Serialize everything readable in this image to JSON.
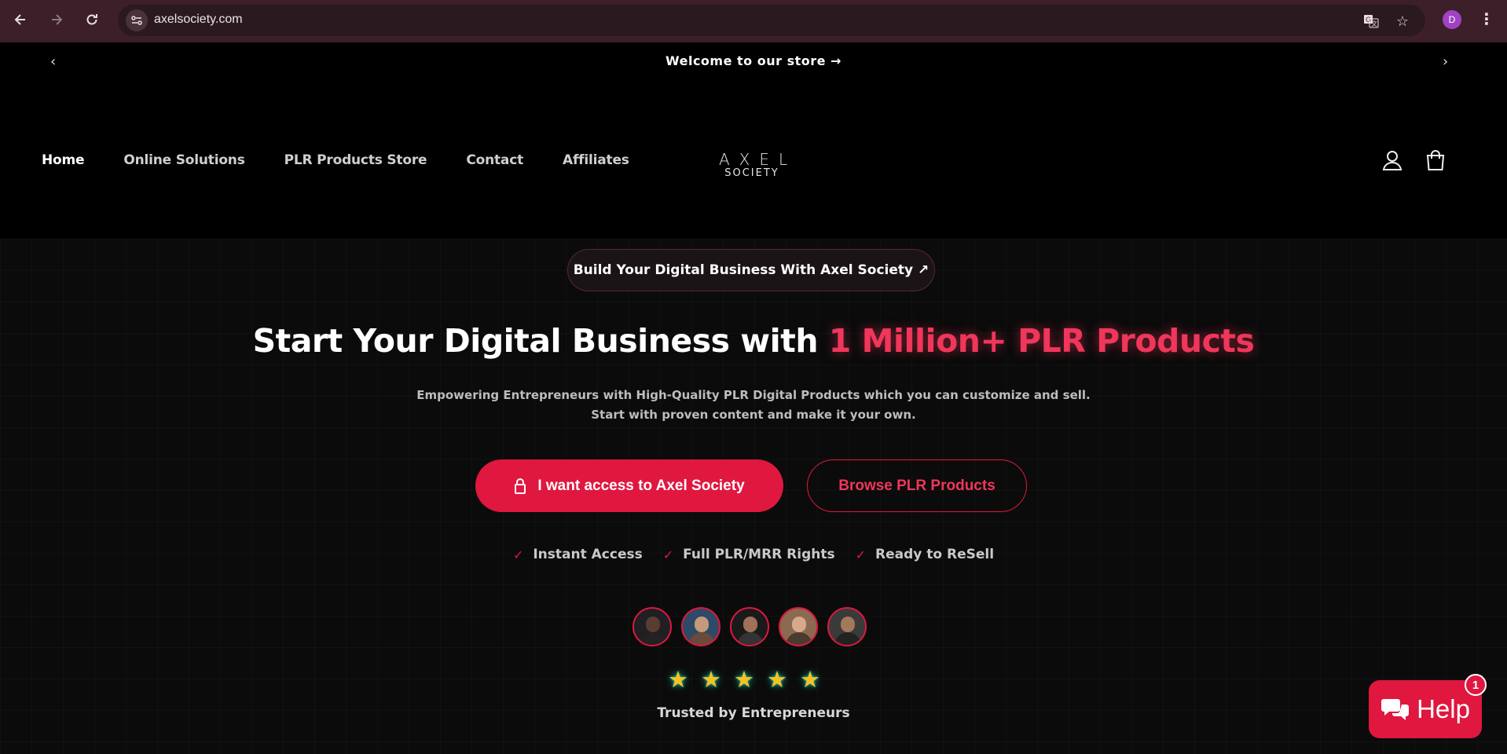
{
  "browser": {
    "url": "axelsociety.com",
    "profile_initial": "D"
  },
  "announcement": {
    "text": "Welcome to our store →"
  },
  "header": {
    "nav": [
      {
        "label": "Home",
        "active": true
      },
      {
        "label": "Online Solutions"
      },
      {
        "label": "PLR Products Store"
      },
      {
        "label": "Contact"
      },
      {
        "label": "Affiliates"
      }
    ],
    "logo_line1": "AXEL",
    "logo_line2": "SOCIETY"
  },
  "hero": {
    "pill": "Build Your Digital Business With Axel Society ↗",
    "headline_start": "Start Your Digital Business with ",
    "headline_accent": "1 Million+ PLR Products",
    "sub_line1": "Empowering Entrepreneurs with High-Quality PLR Digital Products which you can customize and sell.",
    "sub_line2": "Start with proven content and make it your own.",
    "primary_cta": "I want access to Axel Society",
    "secondary_cta": "Browse PLR Products",
    "features": [
      "Instant Access",
      "Full PLR/MRR Rights",
      "Ready to ReSell"
    ],
    "rating_stars": 5,
    "trusted": "Trusted by Entrepreneurs"
  },
  "help": {
    "label": "Help",
    "badge": "1"
  },
  "colors": {
    "accent": "#e0173f",
    "accent_glow": "#f0365a",
    "chrome": "#3c1f29"
  }
}
